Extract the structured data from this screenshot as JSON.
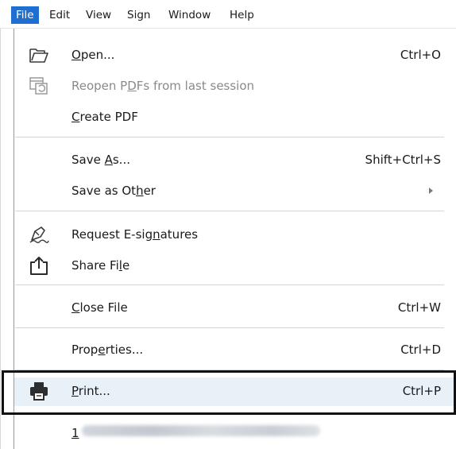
{
  "menubar": {
    "items": [
      "File",
      "Edit",
      "View",
      "Sign",
      "Window",
      "Help"
    ],
    "active": "File",
    "active_color": "#1f6fd0"
  },
  "menu": {
    "open": {
      "pre": "",
      "mnemonic": "O",
      "post": "pen...",
      "shortcut": "Ctrl+O",
      "icon": "folder-open-icon"
    },
    "reopen": {
      "pre": "Reopen P",
      "mnemonic": "D",
      "post": "Fs from last session",
      "icon": "reopen-files-icon",
      "disabled": true
    },
    "create_pdf": {
      "pre": "",
      "mnemonic": "C",
      "post": "reate PDF"
    },
    "save_as": {
      "pre": "Save ",
      "mnemonic": "A",
      "post": "s...",
      "shortcut": "Shift+Ctrl+S"
    },
    "save_as_other": {
      "pre": "Save as Ot",
      "mnemonic": "h",
      "post": "er",
      "has_submenu": true
    },
    "request_esign": {
      "pre": "Request E-sig",
      "mnemonic": "n",
      "post": "atures",
      "icon": "signature-pen-icon"
    },
    "share_file": {
      "pre": "Share Fi",
      "mnemonic": "l",
      "post": "e",
      "icon": "share-upload-icon"
    },
    "close_file": {
      "pre": "",
      "mnemonic": "C",
      "post": "lose File",
      "shortcut": "Ctrl+W"
    },
    "properties": {
      "pre": "Prop",
      "mnemonic": "e",
      "post": "rties...",
      "shortcut": "Ctrl+D"
    },
    "print": {
      "pre": "",
      "mnemonic": "P",
      "post": "rint...",
      "shortcut": "Ctrl+P",
      "icon": "printer-icon"
    },
    "recent_1": {
      "mnemonic": "1"
    }
  },
  "colors": {
    "highlight_bg": "#e8f0f8",
    "callout_border": "#111111",
    "disabled_text": "#8a8a8a"
  }
}
